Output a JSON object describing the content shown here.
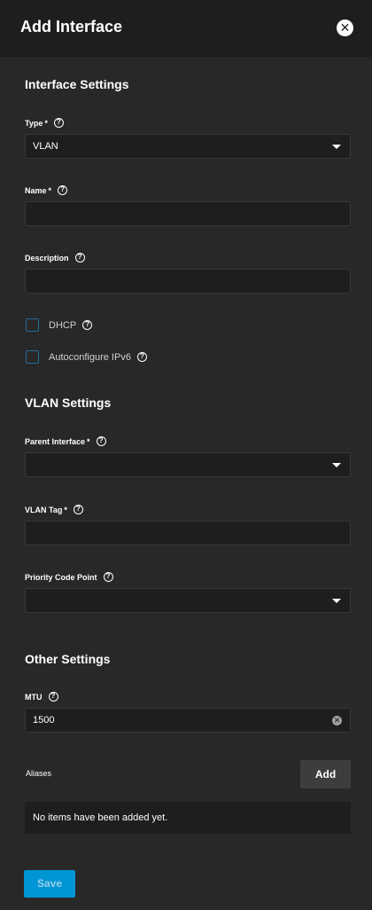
{
  "header": {
    "title": "Add Interface",
    "close_icon": "close-icon"
  },
  "sections": {
    "interface_settings": "Interface Settings",
    "vlan_settings": "VLAN Settings",
    "other_settings": "Other Settings"
  },
  "fields": {
    "type": {
      "label": "Type",
      "required": "*",
      "value": "VLAN"
    },
    "name": {
      "label": "Name",
      "required": "*",
      "value": ""
    },
    "description": {
      "label": "Description",
      "value": ""
    },
    "dhcp": {
      "label": "DHCP",
      "checked": false
    },
    "autoconfigure_ipv6": {
      "label": "Autoconfigure IPv6",
      "checked": false
    },
    "parent_interface": {
      "label": "Parent Interface",
      "required": "*",
      "value": ""
    },
    "vlan_tag": {
      "label": "VLAN Tag",
      "required": "*",
      "value": ""
    },
    "priority_code_point": {
      "label": "Priority Code Point",
      "value": ""
    },
    "mtu": {
      "label": "MTU",
      "value": "1500"
    }
  },
  "aliases": {
    "label": "Aliases",
    "add_label": "Add",
    "empty_text": "No items have been added yet."
  },
  "footer": {
    "save_label": "Save"
  },
  "help_glyph": "?",
  "colors": {
    "accent": "#0095d5",
    "checkbox_border": "#1f6b99",
    "background": "#282828"
  }
}
